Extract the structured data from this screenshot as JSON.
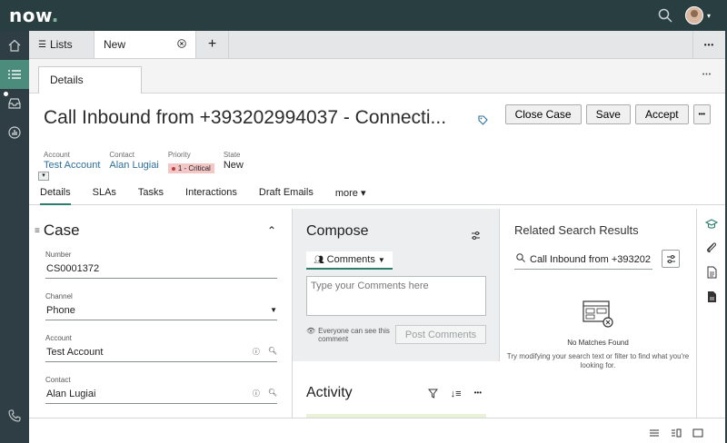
{
  "brand": {
    "logo_text": "now",
    "accent": "#81b5a1",
    "topbar_bg": "#293e40"
  },
  "tabs": {
    "lists_label": "Lists",
    "active_label": "New",
    "more_label": "•••"
  },
  "subtab": {
    "label": "Details",
    "more_label": "•••"
  },
  "record": {
    "title": "Call Inbound from +393202994037 - Connecti...",
    "account_label": "Account",
    "account_value": "Test Account",
    "contact_label": "Contact",
    "contact_value": "Alan Lugiai",
    "priority_label": "Priority",
    "priority_value": "1 - Critical",
    "state_label": "State",
    "state_value": "New"
  },
  "actions": {
    "close_case": "Close Case",
    "save": "Save",
    "accept": "Accept",
    "more": "•••"
  },
  "form_tabs": [
    "Details",
    "SLAs",
    "Tasks",
    "Interactions",
    "Draft Emails",
    "more ▾"
  ],
  "case_section": {
    "heading": "Case",
    "fields": [
      {
        "label": "Number",
        "value": "CS0001372"
      },
      {
        "label": "Channel",
        "value": "Phone"
      },
      {
        "label": "Account",
        "value": "Test Account"
      },
      {
        "label": "Contact",
        "value": "Alan Lugiai"
      }
    ]
  },
  "compose": {
    "heading": "Compose",
    "comments_tab": "Comments",
    "placeholder": "Type your Comments here",
    "visibility": "Everyone can see this comment",
    "post_button": "Post Comments",
    "activity_heading": "Activity"
  },
  "related": {
    "heading": "Related Search Results",
    "search_value": "Call Inbound from +393202",
    "no_match_title": "No Matches Found",
    "no_match_text": "Try modifying your search text or filter to find what you're looking for."
  }
}
